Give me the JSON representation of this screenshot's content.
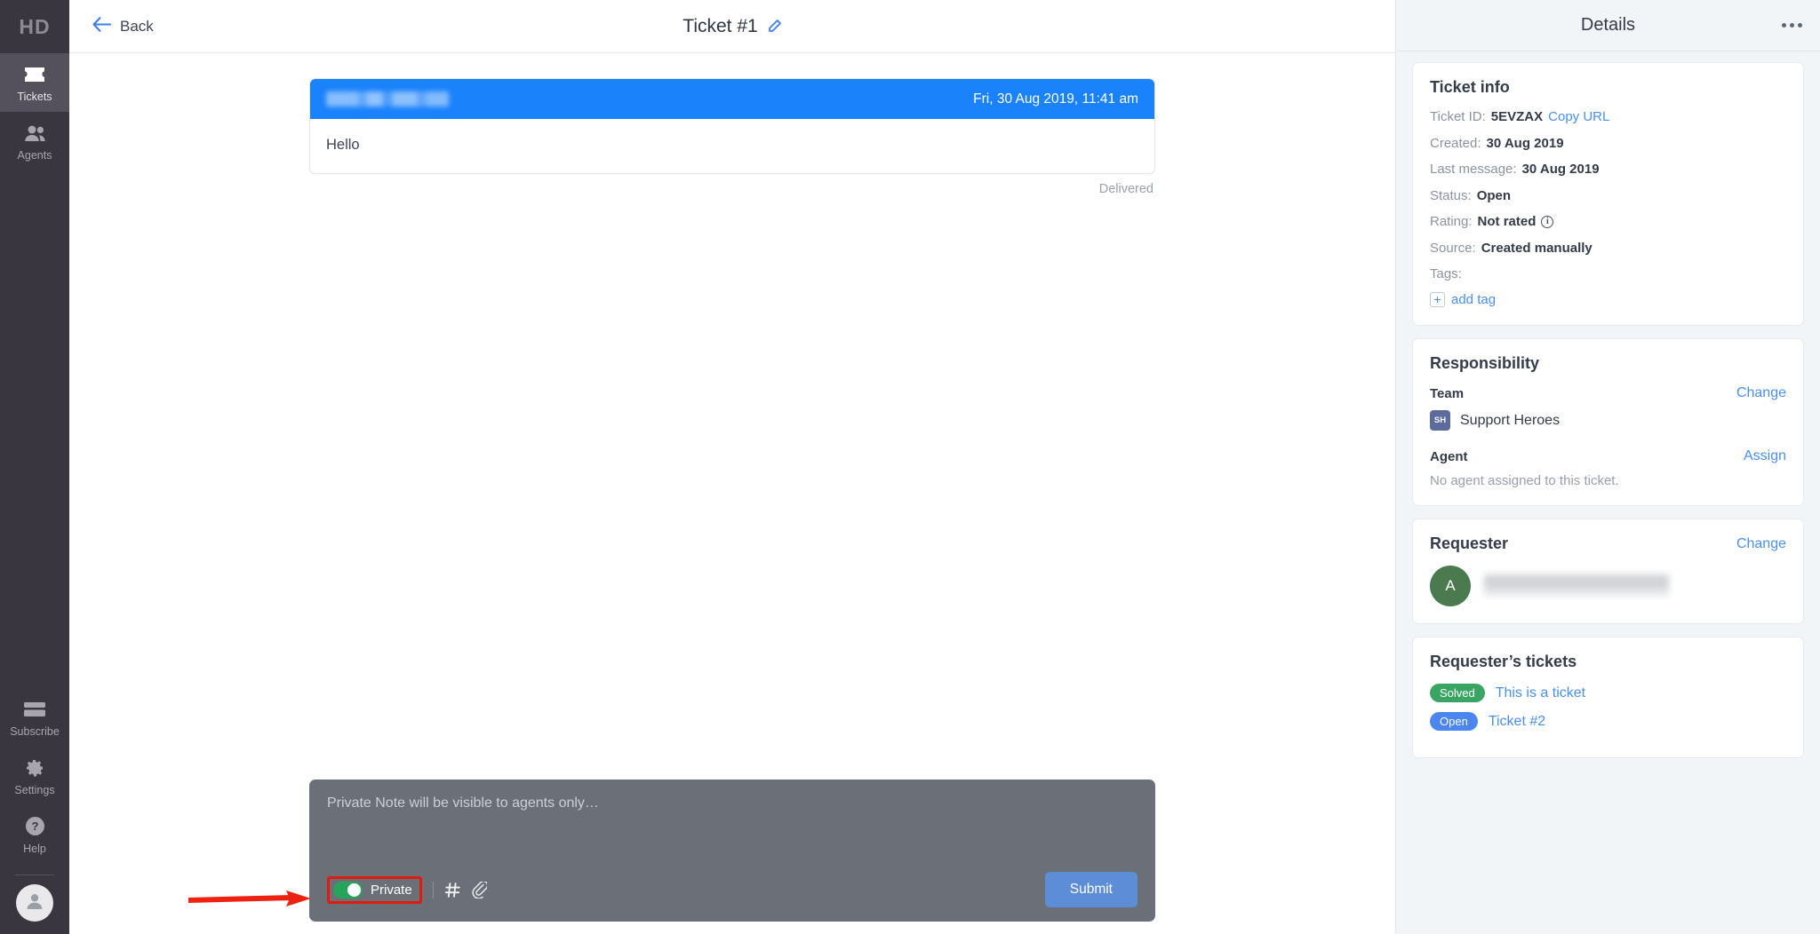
{
  "sidebar": {
    "logo": "HD",
    "items": [
      {
        "label": "Tickets",
        "icon": "ticket-icon",
        "active": true
      },
      {
        "label": "Agents",
        "icon": "agents-icon",
        "active": false
      }
    ],
    "bottom_items": [
      {
        "label": "Subscribe",
        "icon": "card-icon"
      },
      {
        "label": "Settings",
        "icon": "gear-icon"
      },
      {
        "label": "Help",
        "icon": "question-circle-icon"
      }
    ],
    "avatar_icon": "user-avatar-icon"
  },
  "topbar": {
    "back_label": "Back",
    "back_icon": "arrow-left-icon",
    "title": "Ticket #1",
    "edit_icon": "pencil-icon"
  },
  "thread": {
    "message": {
      "sender_redacted": true,
      "timestamp": "Fri, 30 Aug 2019, 11:41 am",
      "body": "Hello",
      "status": "Delivered"
    }
  },
  "composer": {
    "placeholder": "Private Note will be visible to agents only…",
    "toggle_label": "Private",
    "toggle_on": true,
    "hash_icon": "hash-icon",
    "attach_icon": "paperclip-icon",
    "submit_label": "Submit"
  },
  "details": {
    "header_title": "Details",
    "more_icon": "more-horizontal-icon",
    "ticket_info": {
      "title": "Ticket info",
      "rows": [
        {
          "label": "Ticket ID:",
          "value": "5EVZAX",
          "link": "Copy URL"
        },
        {
          "label": "Created:",
          "value": "30 Aug 2019"
        },
        {
          "label": "Last message:",
          "value": "30 Aug 2019"
        },
        {
          "label": "Status:",
          "value": "Open"
        },
        {
          "label": "Rating:",
          "value": "Not rated",
          "info_icon": "info-circle-icon"
        },
        {
          "label": "Source:",
          "value": "Created manually"
        }
      ],
      "tags_label": "Tags:",
      "add_tag_label": "add tag",
      "add_tag_icon": "plus-icon"
    },
    "responsibility": {
      "title": "Responsibility",
      "team_label": "Team",
      "team_action": "Change",
      "team_badge": "SH",
      "team_name": "Support Heroes",
      "agent_label": "Agent",
      "agent_action": "Assign",
      "agent_empty": "No agent assigned to this ticket."
    },
    "requester": {
      "title": "Requester",
      "action": "Change",
      "avatar_initial": "A",
      "name_redacted": true
    },
    "requester_tickets": {
      "title": "Requester’s tickets",
      "items": [
        {
          "status": "Solved",
          "title": "This is a ticket"
        },
        {
          "status": "Open",
          "title": "Ticket #2"
        }
      ]
    }
  },
  "annotation": {
    "arrow_color": "#ee2211",
    "highlight_color": "#e11b0c",
    "target": "private-toggle"
  },
  "colors": {
    "accent_blue": "#1a82fb",
    "link_blue": "#4a90f0",
    "sidebar_bg": "#3a3640",
    "panel_bg": "#f2f5f8",
    "toggle_green": "#27a35a",
    "solved_green": "#3aa463",
    "open_blue": "#4a85f0",
    "submit_blue": "#5d8dd6",
    "composer_bg": "#6b7078"
  }
}
